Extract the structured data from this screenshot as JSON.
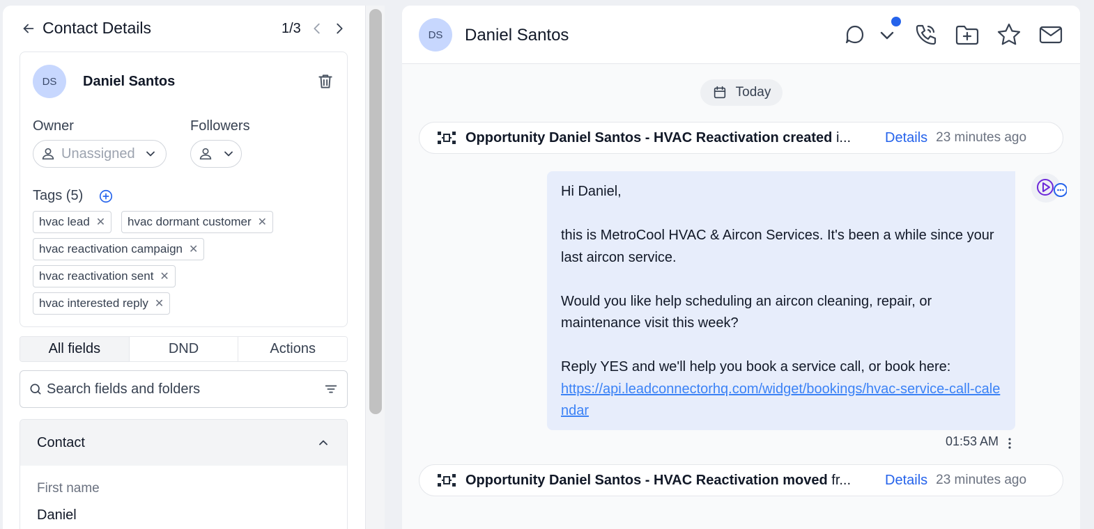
{
  "left_panel": {
    "title": "Contact Details",
    "pager": "1/3",
    "contact": {
      "initials": "DS",
      "name": "Daniel Santos"
    },
    "owner": {
      "label": "Owner",
      "placeholder": "Unassigned"
    },
    "followers": {
      "label": "Followers"
    },
    "tags": {
      "label": "Tags (5)",
      "items": [
        "hvac lead",
        "hvac dormant customer",
        "hvac reactivation campaign",
        "hvac reactivation sent",
        "hvac interested reply"
      ]
    },
    "tabs": [
      "All fields",
      "DND",
      "Actions"
    ],
    "active_tab": "All fields",
    "search": {
      "placeholder": "Search fields and folders"
    },
    "section": {
      "title": "Contact",
      "field_label": "First name",
      "field_value": "Daniel"
    }
  },
  "conversation": {
    "initials": "DS",
    "name": "Daniel Santos",
    "header_icons": [
      "chat-bubble-icon",
      "chevron-down-icon",
      "phone-icon",
      "folder-plus-icon",
      "star-icon",
      "mail-icon"
    ],
    "date_label": "Today",
    "activities": [
      {
        "bold": "Opportunity Daniel Santos - HVAC Reactivation created",
        "rest": " i...",
        "details": "Details",
        "ago": "23 minutes ago"
      },
      {
        "bold": "Opportunity Daniel Santos - HVAC Reactivation moved",
        "rest": " fr...",
        "details": "Details",
        "ago": "23 minutes ago"
      }
    ],
    "message": {
      "greeting": "Hi Daniel,",
      "para1": "this is MetroCool HVAC & Aircon Services. It's been a while since your last aircon service.",
      "para2": "Would you like help scheduling an aircon cleaning, repair, or maintenance visit this week?",
      "para3": "Reply YES and we'll help you book a service call, or book here:",
      "link": "https://api.leadconnectorhq.com/widget/bookings/hvac-service-call-calendar",
      "time": "01:53 AM"
    }
  },
  "colors": {
    "accent": "#2563eb",
    "avatar_bg": "#c7d7fe",
    "bubble_bg": "#e7edfb",
    "link": "#3b82f6"
  }
}
